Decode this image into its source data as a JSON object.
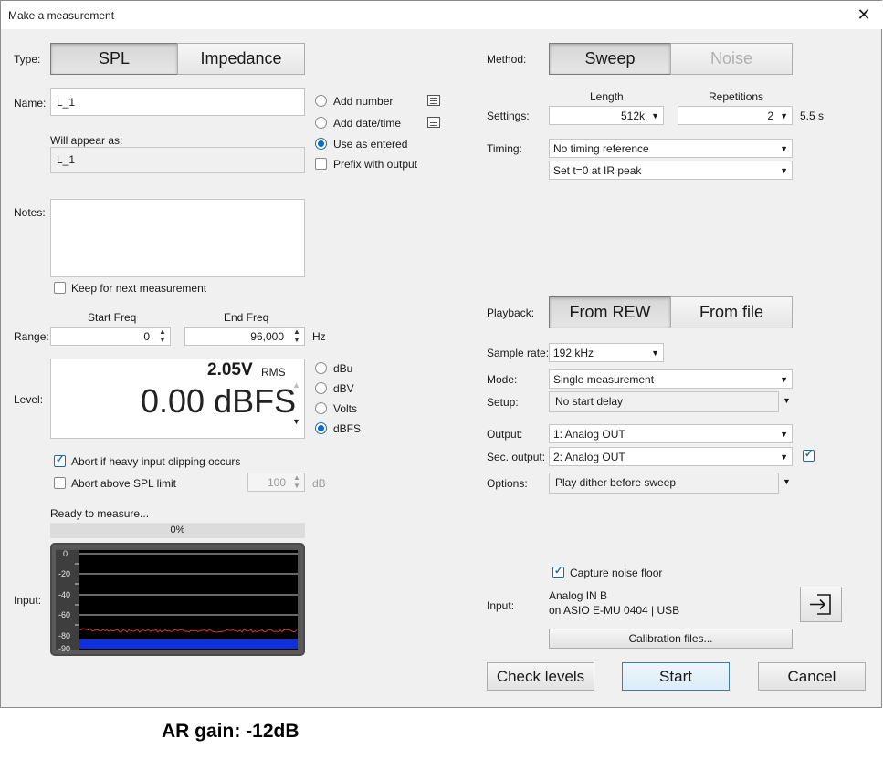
{
  "window": {
    "title": "Make a measurement",
    "close_glyph": "✕"
  },
  "type": {
    "label": "Type:",
    "options": [
      "SPL",
      "Impedance"
    ],
    "selected": "SPL"
  },
  "name": {
    "label": "Name:",
    "value": "L_1",
    "will_appear_label": "Will appear as:",
    "will_appear_value": "L_1",
    "naming_options": [
      {
        "label": "Add number",
        "selected": false
      },
      {
        "label": "Add date/time",
        "selected": false
      },
      {
        "label": "Use as entered",
        "selected": true
      }
    ],
    "prefix_with_output": {
      "label": "Prefix with output",
      "checked": false
    }
  },
  "notes": {
    "label": "Notes:",
    "value": "",
    "keep_label": "Keep for next measurement",
    "keep_checked": false
  },
  "range": {
    "label": "Range:",
    "start_header": "Start Freq",
    "end_header": "End Freq",
    "start_value": "0",
    "end_value": "96,000",
    "unit": "Hz"
  },
  "level": {
    "label": "Level:",
    "rms_value": "2.05V",
    "rms_unit": "RMS",
    "value": "0.00 dBFS",
    "units": [
      {
        "label": "dBu",
        "selected": false
      },
      {
        "label": "dBV",
        "selected": false
      },
      {
        "label": "Volts",
        "selected": false
      },
      {
        "label": "dBFS",
        "selected": true
      }
    ]
  },
  "abort": {
    "clipping_label": "Abort if heavy input clipping occurs",
    "clipping_checked": true,
    "spl_label": "Abort above SPL limit",
    "spl_checked": false,
    "spl_limit": "100",
    "spl_unit": "dB"
  },
  "status": {
    "text": "Ready to measure...",
    "progress_text": "0%",
    "progress": 0
  },
  "input_meter": {
    "label": "Input:",
    "scale": [
      "0",
      "-20",
      "-40",
      "-60",
      "-80",
      "-90"
    ],
    "colors": {
      "background": "#000000",
      "noise_trace": "#d23a2a",
      "floor": "#1030e0"
    }
  },
  "method": {
    "label": "Method:",
    "options": [
      "Sweep",
      "Noise"
    ],
    "selected": "Sweep"
  },
  "settings": {
    "label": "Settings:",
    "length_header": "Length",
    "repetitions_header": "Repetitions",
    "length": "512k",
    "repetitions": "2",
    "duration": "5.5 s"
  },
  "timing": {
    "label": "Timing:",
    "reference": "No timing reference",
    "t0": "Set t=0 at IR peak"
  },
  "playback": {
    "label": "Playback:",
    "options": [
      "From REW",
      "From file"
    ],
    "selected": "From REW"
  },
  "sample_rate": {
    "label": "Sample rate:",
    "value": "192 kHz"
  },
  "mode": {
    "label": "Mode:",
    "value": "Single measurement"
  },
  "setup": {
    "label": "Setup:",
    "value": "No start delay"
  },
  "output": {
    "label": "Output:",
    "value": "1: Analog OUT"
  },
  "sec_output": {
    "label": "Sec. output:",
    "value": "2: Analog OUT",
    "enabled": true
  },
  "options": {
    "label": "Options:",
    "value": "Play dither before sweep"
  },
  "input_device": {
    "capture_label": "Capture noise floor",
    "capture_checked": true,
    "label": "Input:",
    "line1": "Analog IN B",
    "line2": "on ASIO E-MU 0404 | USB",
    "calibration_button": "Calibration files...",
    "icon": "input-select-icon"
  },
  "footer": {
    "check_levels": "Check levels",
    "start": "Start",
    "cancel": "Cancel"
  },
  "caption": "AR gain: -12dB"
}
